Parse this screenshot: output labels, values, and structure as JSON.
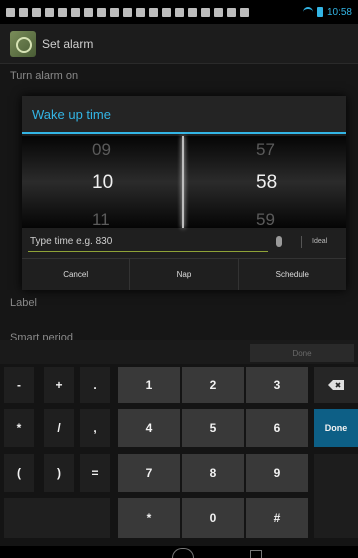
{
  "status_bar": {
    "time": "10:58"
  },
  "action_bar": {
    "title": "Set alarm"
  },
  "settings": {
    "turn_alarm_on": "Turn alarm on",
    "label": "Label",
    "smart_period": "Smart period"
  },
  "dialog": {
    "title": "Wake up time",
    "hours": {
      "prev": "09",
      "current": "10",
      "next": "11"
    },
    "minutes": {
      "prev": "57",
      "current": "58",
      "next": "59"
    },
    "input_placeholder": "Type time e.g. 830",
    "ideal_label": "Ideal",
    "buttons": {
      "cancel": "Cancel",
      "nap": "Nap",
      "schedule": "Schedule"
    }
  },
  "keyboard": {
    "done_label": "Done",
    "action_label": "Done",
    "left_keys": [
      "-",
      "+",
      ".",
      "*",
      "/",
      ",",
      "(",
      ")",
      "="
    ],
    "number_keys": [
      "1",
      "2",
      "3",
      "4",
      "5",
      "6",
      "7",
      "8",
      "9",
      "*",
      "0",
      "#"
    ]
  },
  "colors": {
    "accent": "#33b5e5",
    "done_key": "#0d5f86",
    "input_underline": "#8fa337"
  },
  "icons": [
    "app-alarm-icon",
    "microphone-icon",
    "backspace-icon",
    "wifi-icon",
    "battery-icon",
    "home-icon",
    "recents-icon"
  ]
}
